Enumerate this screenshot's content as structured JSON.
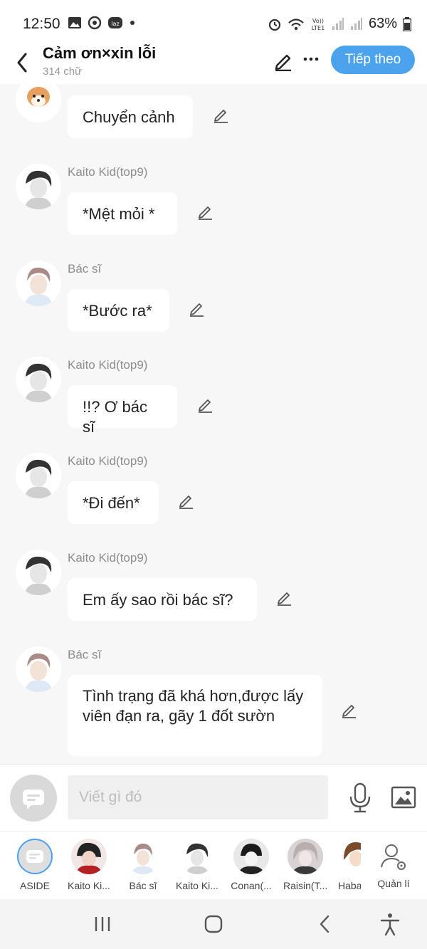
{
  "status_bar": {
    "time": "12:50",
    "battery": "63%",
    "icons_left": [
      "gallery-icon",
      "sync-icon",
      "lazada-icon",
      "dot-icon"
    ],
    "icons_right": [
      "alarm-icon",
      "wifi-icon",
      "volte-icon",
      "signal-icon",
      "signal-icon",
      "battery-icon"
    ]
  },
  "header": {
    "title": "Cảm ơn×xin lỗi",
    "subtitle": "314 chữ",
    "next_label": "Tiếp theo"
  },
  "messages": [
    {
      "sender": "",
      "text": "Chuyển cảnh",
      "avatar": "shiba-avatar"
    },
    {
      "sender": "Kaito Kid(top9)",
      "text": "*Mệt mỏi *",
      "avatar": "kaito-avatar"
    },
    {
      "sender": "Bác sĩ",
      "text": "*Bước ra*",
      "avatar": "doctor-avatar"
    },
    {
      "sender": "Kaito Kid(top9)",
      "text": "!!? Ơ bác sĩ",
      "avatar": "kaito-avatar"
    },
    {
      "sender": "Kaito Kid(top9)",
      "text": "*Đi đến*",
      "avatar": "kaito-avatar"
    },
    {
      "sender": "Kaito Kid(top9)",
      "text": "Em ấy sao rồi bác sĩ?",
      "avatar": "kaito-avatar"
    },
    {
      "sender": "Bác sĩ",
      "text": "Tình trạng đã khá hơn,được lấy viên đạn ra, gãy 1 đốt sườn",
      "avatar": "doctor-avatar"
    }
  ],
  "input": {
    "placeholder": "Viết gì đó"
  },
  "characters": [
    {
      "label": "ASIDE"
    },
    {
      "label": "Kaito Ki..."
    },
    {
      "label": "Bác sĩ"
    },
    {
      "label": "Kaito Ki..."
    },
    {
      "label": "Conan(..."
    },
    {
      "label": "Raisin(T..."
    },
    {
      "label": "Haba"
    },
    {
      "label": "Quản lí"
    }
  ],
  "colors": {
    "accent": "#4aa3ec",
    "background": "#f7f7f7",
    "bubble": "#ffffff",
    "sender_text": "#8d8d8d"
  }
}
